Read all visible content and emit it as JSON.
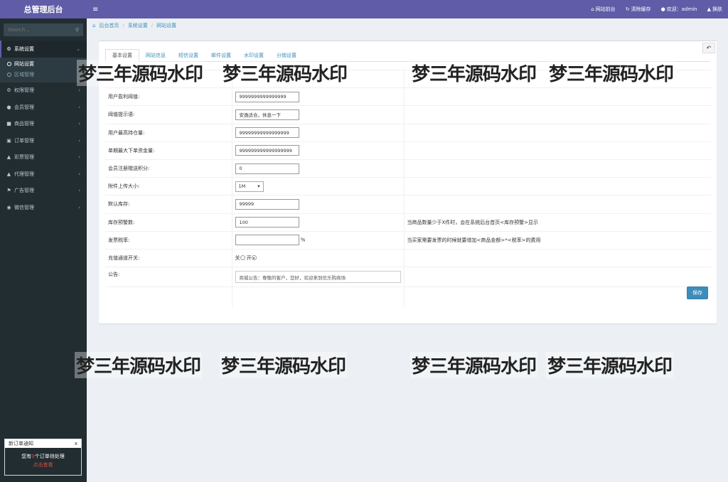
{
  "sidebar": {
    "logo": "总管理后台",
    "search_placeholder": "Search...",
    "items": [
      {
        "label": "系统设置",
        "icon": "gear-icon"
      },
      {
        "label": "权限管理",
        "icon": "gears-icon"
      },
      {
        "label": "会员管理",
        "icon": "user-icon"
      },
      {
        "label": "商品管理",
        "icon": "cube-icon"
      },
      {
        "label": "订单管理",
        "icon": "money-icon"
      },
      {
        "label": "彩票管理",
        "icon": "bell-icon"
      },
      {
        "label": "代理管理",
        "icon": "bell-icon"
      },
      {
        "label": "广告管理",
        "icon": "flag-icon"
      },
      {
        "label": "微信管理",
        "icon": "wechat-icon"
      }
    ],
    "submenu": [
      {
        "label": "网站设置"
      },
      {
        "label": "区域管理"
      }
    ],
    "notify": {
      "title": "新订单通知",
      "close": "x",
      "text_before": "您有",
      "count": "0",
      "text_after": "个订单待处理",
      "link": "点击查看"
    }
  },
  "header": {
    "menu_toggle": "≡",
    "links": [
      {
        "label": "网站前台"
      },
      {
        "label": "清除缓存"
      },
      {
        "label": "欢迎：admin"
      },
      {
        "label": "换肤"
      }
    ]
  },
  "breadcrumb": {
    "items": [
      "后台首页",
      "系统设置",
      "网站设置"
    ],
    "sep": "/"
  },
  "tabs": [
    "基本设置",
    "网站信息",
    "短信设置",
    "邮件设置",
    "水印设置",
    "分销设置"
  ],
  "form": {
    "rows": [
      {
        "label": "",
        "value": "",
        "note": ""
      },
      {
        "label": "用户盈利阈值:",
        "value": "9999999999999999",
        "note": ""
      },
      {
        "label": "阈值提示语:",
        "value": "安逸适合，休息一下",
        "note": ""
      },
      {
        "label": "用户最高持仓量:",
        "value": "99999999999999999",
        "note": ""
      },
      {
        "label": "单期最大下单资金量:",
        "value": "999999999999999999",
        "note": ""
      },
      {
        "label": "会员注册赠送积分:",
        "value": "0",
        "note": ""
      },
      {
        "label": "附件上传大小:",
        "value": "1M",
        "note": ""
      },
      {
        "label": "默认库存:",
        "value": "99999",
        "note": ""
      },
      {
        "label": "库存预警数:",
        "value": "100",
        "note": "当商品数量少于X件时，会在系统后台首页<库存预警>显示"
      },
      {
        "label": "发票税率:",
        "value": "",
        "unit": "%",
        "note": "当买家需要发票的时候就要增加<商品金额>*<税率>的费用"
      },
      {
        "label": "充值通道开关:",
        "off": "关",
        "on": "开",
        "note": ""
      },
      {
        "label": "公告:",
        "value": "商城公告：尊敬的客户，您好，欢迎来到优乐购商场",
        "note": ""
      }
    ],
    "save": "保存"
  },
  "watermark": "梦三年源码水印"
}
